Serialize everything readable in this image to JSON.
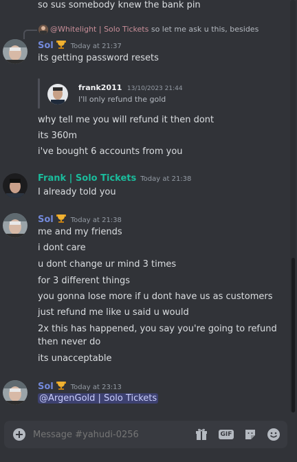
{
  "messages": {
    "top_line": "so sus somebody knew the bank pin",
    "group1": {
      "reply_author": "@Whitelight | Solo Tickets",
      "reply_text": "so let me ask u this, besides t!",
      "author": "Sol",
      "time": "Today at 21:37",
      "line1": "its getting password resets",
      "quote_author": "frank2011",
      "quote_date": "13/10/2023 21:44",
      "quote_text": "I'll only refund the gold",
      "line2": "why tell me you will refund it then dont",
      "line3": "its 360m",
      "line4": "i've bought 6 accounts from you"
    },
    "group2": {
      "author": "Frank | Solo Tickets",
      "time": "Today at 21:38",
      "line1": "I already told you"
    },
    "group3": {
      "author": "Sol",
      "time": "Today at 21:38",
      "lines": [
        "me and my friends",
        "i dont care",
        "u dont change ur mind 3 times",
        "for 3 different things",
        "you gonna lose more if u dont have us as customers",
        "just refund me like u said u would",
        "2x this has happened, you say you're going to refund",
        "then never do",
        "its unacceptable"
      ]
    },
    "group4": {
      "author": "Sol",
      "time": "Today at 23:13",
      "mention": "@ArgenGold | Solo Tickets"
    }
  },
  "composer": {
    "placeholder": "Message #yahudi-0256",
    "add_icon": "plus-circle-icon",
    "gift_icon": "gift-icon",
    "gif_label": "GIF",
    "sticker_icon": "sticker-icon",
    "emoji_icon": "emoji-icon"
  },
  "colors": {
    "background": "#313338",
    "sol_name": "#7289da",
    "frank_name": "#1abc9c",
    "reply_author": "#c98f99"
  }
}
